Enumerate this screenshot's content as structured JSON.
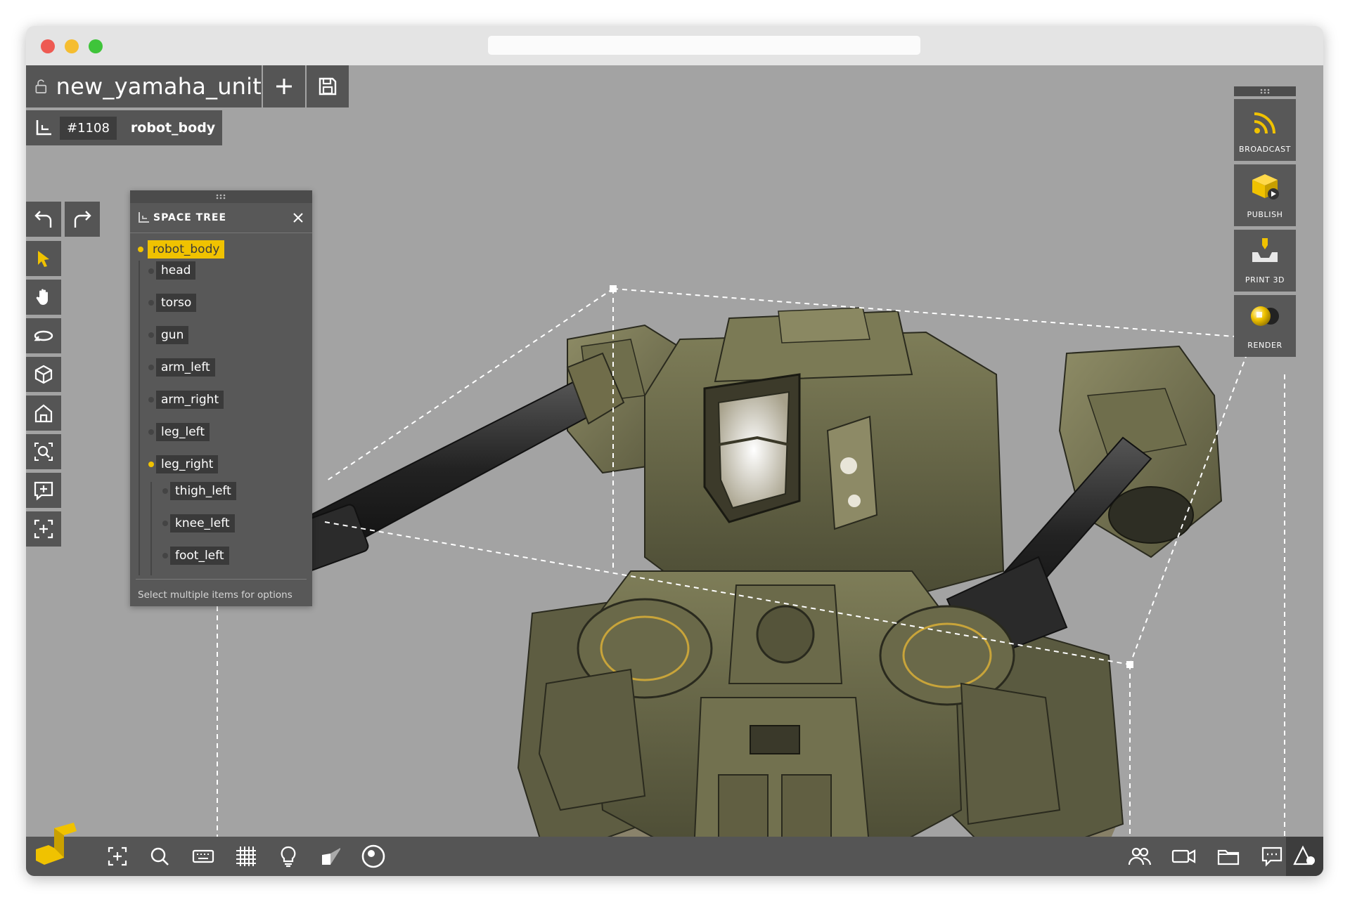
{
  "document": {
    "name": "new_yamaha_unit",
    "new_button": "+"
  },
  "breadcrumb": {
    "id": "#1108",
    "name": "robot_body"
  },
  "space_tree": {
    "title": "SPACE TREE",
    "close_label": "×",
    "items": [
      {
        "label": "robot_body",
        "selected": true
      },
      {
        "label": "head"
      },
      {
        "label": "torso"
      },
      {
        "label": "gun"
      },
      {
        "label": "arm_left"
      },
      {
        "label": "arm_right"
      },
      {
        "label": "leg_left"
      },
      {
        "label": "leg_right",
        "expanded": true
      },
      {
        "label": "thigh_left"
      },
      {
        "label": "knee_left"
      },
      {
        "label": "foot_left"
      }
    ],
    "footer": "Select multiple items for options"
  },
  "right_panel": {
    "buttons": [
      {
        "label": "BROADCAST",
        "icon": "broadcast-icon"
      },
      {
        "label": "PUBLISH",
        "icon": "publish-icon"
      },
      {
        "label": "PRINT 3D",
        "icon": "print-3d-icon"
      },
      {
        "label": "RENDER",
        "icon": "render-icon"
      }
    ]
  },
  "left_tools": [
    "undo-icon",
    "redo-icon",
    "select-arrow-icon",
    "pan-hand-icon",
    "orbit-icon",
    "cube-view-icon",
    "home-icon",
    "zoom-icon",
    "zoom-in-icon",
    "fit-view-icon"
  ],
  "bottom_tools": [
    "logo-icon",
    "frame-selection-icon",
    "search-icon",
    "keyboard-icon",
    "grid-icon",
    "light-bulb-icon",
    "material-icon",
    "snapshot-icon",
    "users-icon",
    "camera-icon",
    "layers-icon",
    "comments-icon",
    "shapes-icon"
  ],
  "colors": {
    "accent": "#f0c200",
    "panel": "#555555",
    "viewport": "#a3a3a3"
  }
}
